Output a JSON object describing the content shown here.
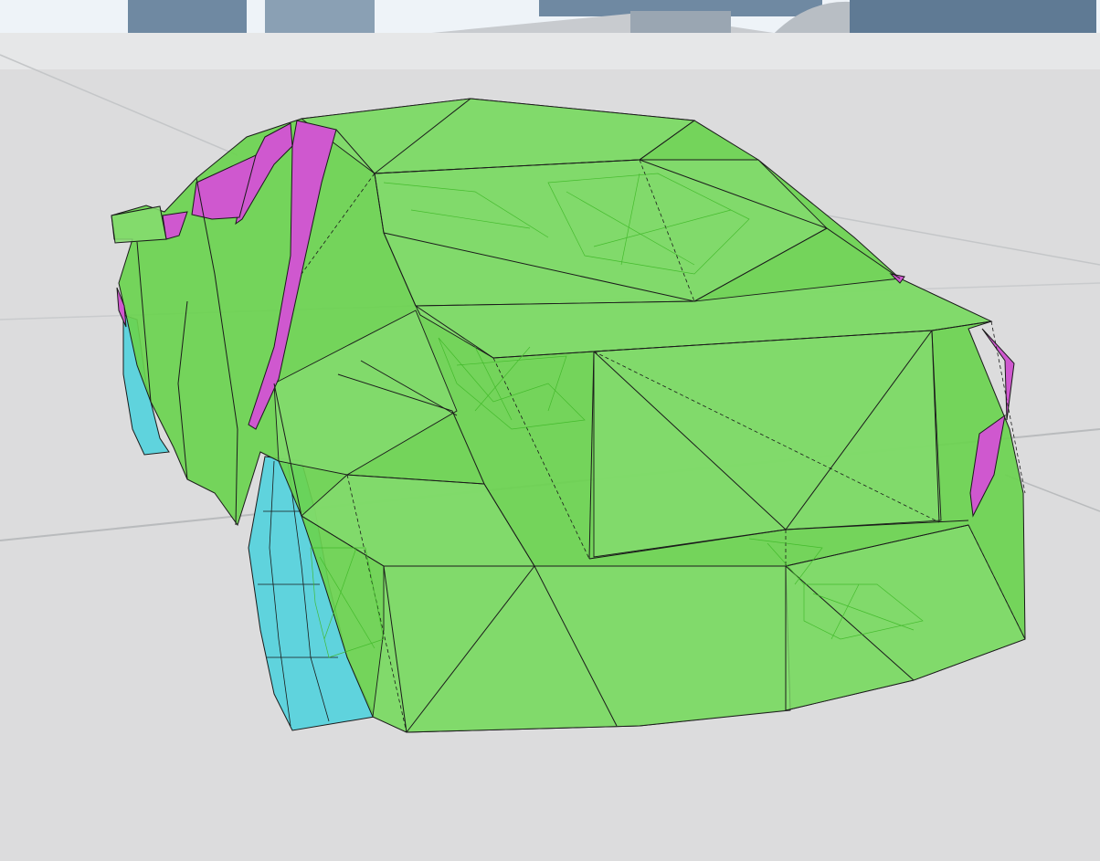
{
  "scene": {
    "view": "3d-viewport",
    "subject": "vehicle-collision-mesh-wireframe",
    "colors": {
      "sky": "#eef3f8",
      "floor": "#dcdcdd",
      "floor_seam": "#b9bbbd",
      "buildings": "#6f89a2",
      "ramp": "#c8cbcf",
      "body_mesh": "#54d33a",
      "body_mesh_light": "#7fde68",
      "window_mesh": "#cf58cf",
      "wheel_mesh": "#5fd3dd",
      "edge": "#1a1a1a",
      "inner_wire": "#49c22f"
    }
  }
}
